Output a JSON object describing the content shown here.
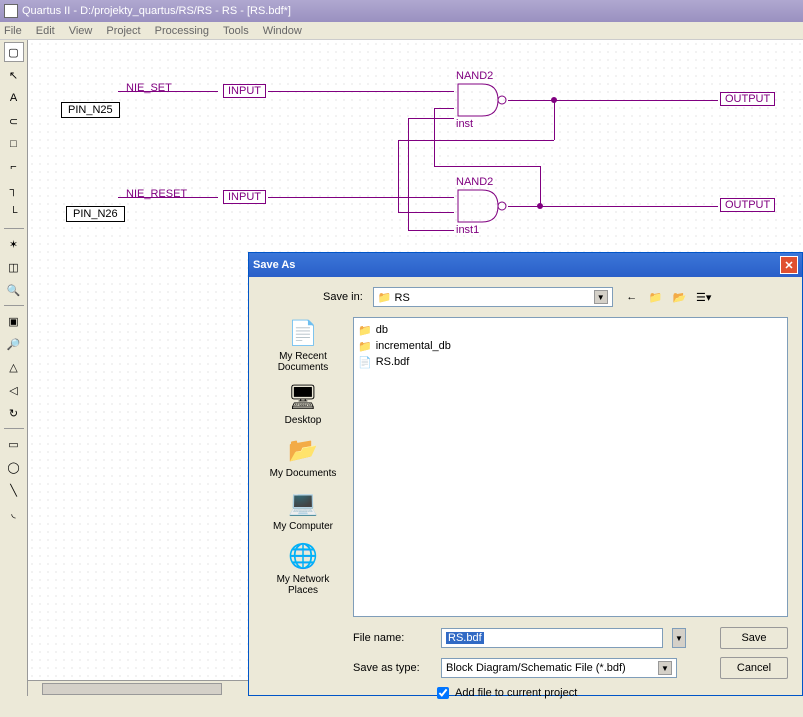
{
  "app": {
    "title": "Quartus II - D:/projekty_quartus/RS/RS - RS - [RS.bdf*]"
  },
  "menu": {
    "items": [
      "File",
      "Edit",
      "View",
      "Project",
      "Processing",
      "Tools",
      "Window"
    ]
  },
  "tools": [
    {
      "name": "block-icon",
      "glyph": "▢"
    },
    {
      "name": "arrow-icon",
      "glyph": "↖"
    },
    {
      "name": "text-icon",
      "glyph": "A"
    },
    {
      "name": "symbol-icon",
      "glyph": "⊂"
    },
    {
      "name": "rect-icon",
      "glyph": "□"
    },
    {
      "name": "ortho-icon",
      "glyph": "⌐"
    },
    {
      "name": "ortho2-icon",
      "glyph": "┐"
    },
    {
      "name": "wire-icon",
      "glyph": "└"
    },
    {
      "name": "signal-icon",
      "glyph": "✶"
    },
    {
      "name": "partial-icon",
      "glyph": "◫"
    },
    {
      "name": "zoom-icon",
      "glyph": "🔍"
    },
    {
      "name": "fullscreen-icon",
      "glyph": "▣"
    },
    {
      "name": "find-icon",
      "glyph": "🔎"
    },
    {
      "name": "flip-h-icon",
      "glyph": "△"
    },
    {
      "name": "flip-v-icon",
      "glyph": "◁"
    },
    {
      "name": "rotate-icon",
      "glyph": "↻"
    },
    {
      "name": "shape-rect-icon",
      "glyph": "▭"
    },
    {
      "name": "shape-oval-icon",
      "glyph": "◯"
    },
    {
      "name": "shape-line-icon",
      "glyph": "╲"
    },
    {
      "name": "shape-arc-icon",
      "glyph": "◟"
    }
  ],
  "schematic": {
    "pin1": "PIN_N25",
    "pin2": "PIN_N26",
    "net_set": "NIE_SET",
    "net_reset": "NIE_RESET",
    "input_label": "INPUT",
    "output_label": "OUTPUT",
    "gate_type": "NAND2",
    "inst1": "inst",
    "inst2": "inst1"
  },
  "dialog": {
    "title": "Save As",
    "savein_label": "Save in:",
    "savein_value": "RS",
    "files": [
      {
        "icon": "📁",
        "name": "db"
      },
      {
        "icon": "📁",
        "name": "incremental_db"
      },
      {
        "icon": "📄",
        "name": "RS.bdf"
      }
    ],
    "places": [
      {
        "name": "My Recent Documents",
        "icon": "📄"
      },
      {
        "name": "Desktop",
        "icon": "🖥"
      },
      {
        "name": "My Documents",
        "icon": "📂"
      },
      {
        "name": "My Computer",
        "icon": "💻"
      },
      {
        "name": "My Network Places",
        "icon": "🌐"
      }
    ],
    "filename_label": "File name:",
    "filename_value": "RS.bdf",
    "filetype_label": "Save as type:",
    "filetype_value": "Block Diagram/Schematic File (*.bdf)",
    "save_btn": "Save",
    "cancel_btn": "Cancel",
    "checkbox_label": "Add file to current project"
  }
}
